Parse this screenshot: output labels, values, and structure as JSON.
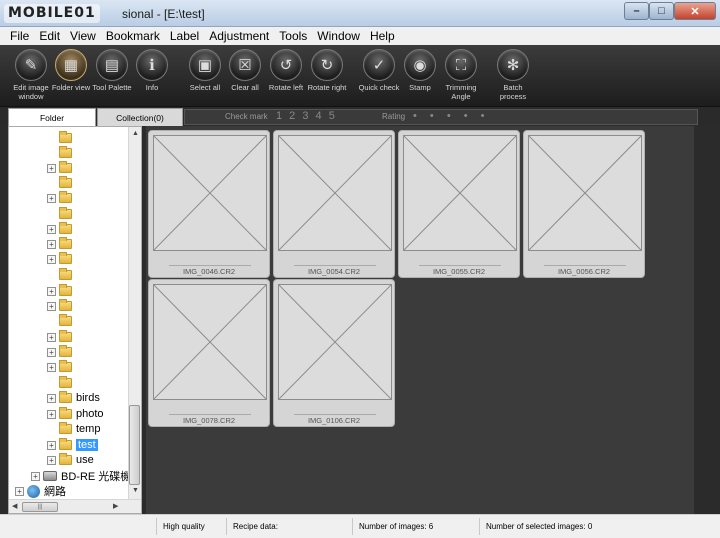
{
  "window": {
    "title": "sional - [E:\\test]",
    "watermark": "MOBILE01"
  },
  "menu": [
    "File",
    "Edit",
    "View",
    "Bookmark",
    "Label",
    "Adjustment",
    "Tools",
    "Window",
    "Help"
  ],
  "toolbar": [
    {
      "label": "Edit image window",
      "icon": "edit-image-icon"
    },
    {
      "label": "Folder view",
      "icon": "folder-view-icon"
    },
    {
      "label": "Tool Palette",
      "icon": "tool-palette-icon"
    },
    {
      "label": "Info",
      "icon": "info-icon"
    },
    {
      "label": "Select all",
      "icon": "select-all-icon"
    },
    {
      "label": "Clear all",
      "icon": "clear-all-icon"
    },
    {
      "label": "Rotate left",
      "icon": "rotate-left-icon"
    },
    {
      "label": "Rotate right",
      "icon": "rotate-right-icon"
    },
    {
      "label": "Quick check",
      "icon": "quick-check-icon"
    },
    {
      "label": "Stamp",
      "icon": "stamp-icon"
    },
    {
      "label": "Trimming Angle",
      "icon": "trimming-angle-icon"
    },
    {
      "label": "Batch process",
      "icon": "batch-process-icon"
    }
  ],
  "tabs": {
    "folder": "Folder",
    "collection": "Collection(0)"
  },
  "filter": {
    "check_mark_label": "Check mark",
    "check_marks": "1 2 3 4 5",
    "rating_label": "Rating",
    "rating_dots": "• • • • •"
  },
  "tree": {
    "named_folders": [
      "birds",
      "photo",
      "temp",
      "test",
      "use"
    ],
    "selected": "test",
    "drive": "BD-RE 光碟機",
    "network": "網路"
  },
  "thumbnails": [
    "IMG_0046.CR2",
    "IMG_0054.CR2",
    "IMG_0055.CR2",
    "IMG_0056.CR2",
    "IMG_0078.CR2",
    "IMG_0106.CR2"
  ],
  "status": {
    "quality": "High quality",
    "recipe": "Recipe data:",
    "num_images": "Number of images: 6",
    "num_selected": "Number of selected images: 0"
  },
  "colors": {
    "toolbar_bg": "#2a2a2a",
    "grid_bg": "#3b3b3b",
    "selection": "#3399ff",
    "close_button": "#c4422a"
  }
}
